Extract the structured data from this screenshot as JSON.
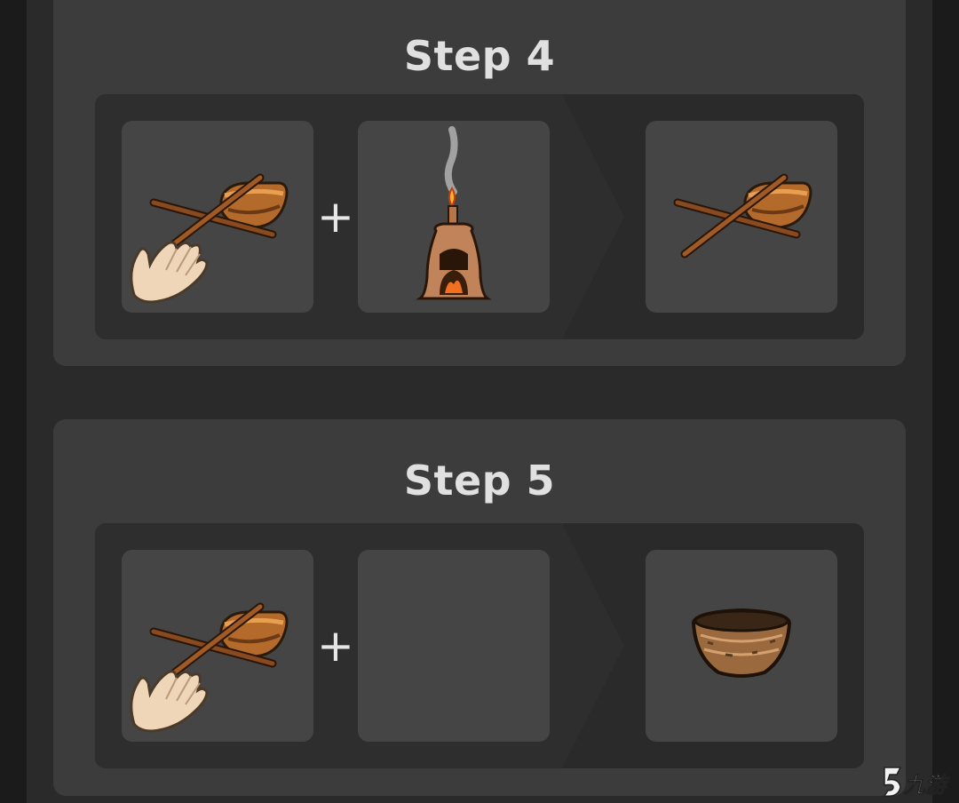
{
  "steps": [
    {
      "title": "Step 4",
      "inputs": [
        {
          "item": "stick-and-bowl",
          "hand_icon": true
        },
        {
          "item": "kiln-with-flame"
        }
      ],
      "operator": "+",
      "output": {
        "item": "stick-and-bowl"
      }
    },
    {
      "title": "Step 5",
      "inputs": [
        {
          "item": "stick-and-bowl",
          "hand_icon": true
        },
        {
          "item": "empty"
        }
      ],
      "operator": "+",
      "output": {
        "item": "clay-bowl"
      }
    }
  ],
  "watermark": {
    "text": "九游",
    "icon": "9game-logo"
  },
  "colors": {
    "page_bg": "#1b1b1b",
    "card_bg": "#3c3c3c",
    "panel_bg": "#2b2b2b",
    "slot_bg": "#454545",
    "title_text": "#e0e0e0"
  }
}
